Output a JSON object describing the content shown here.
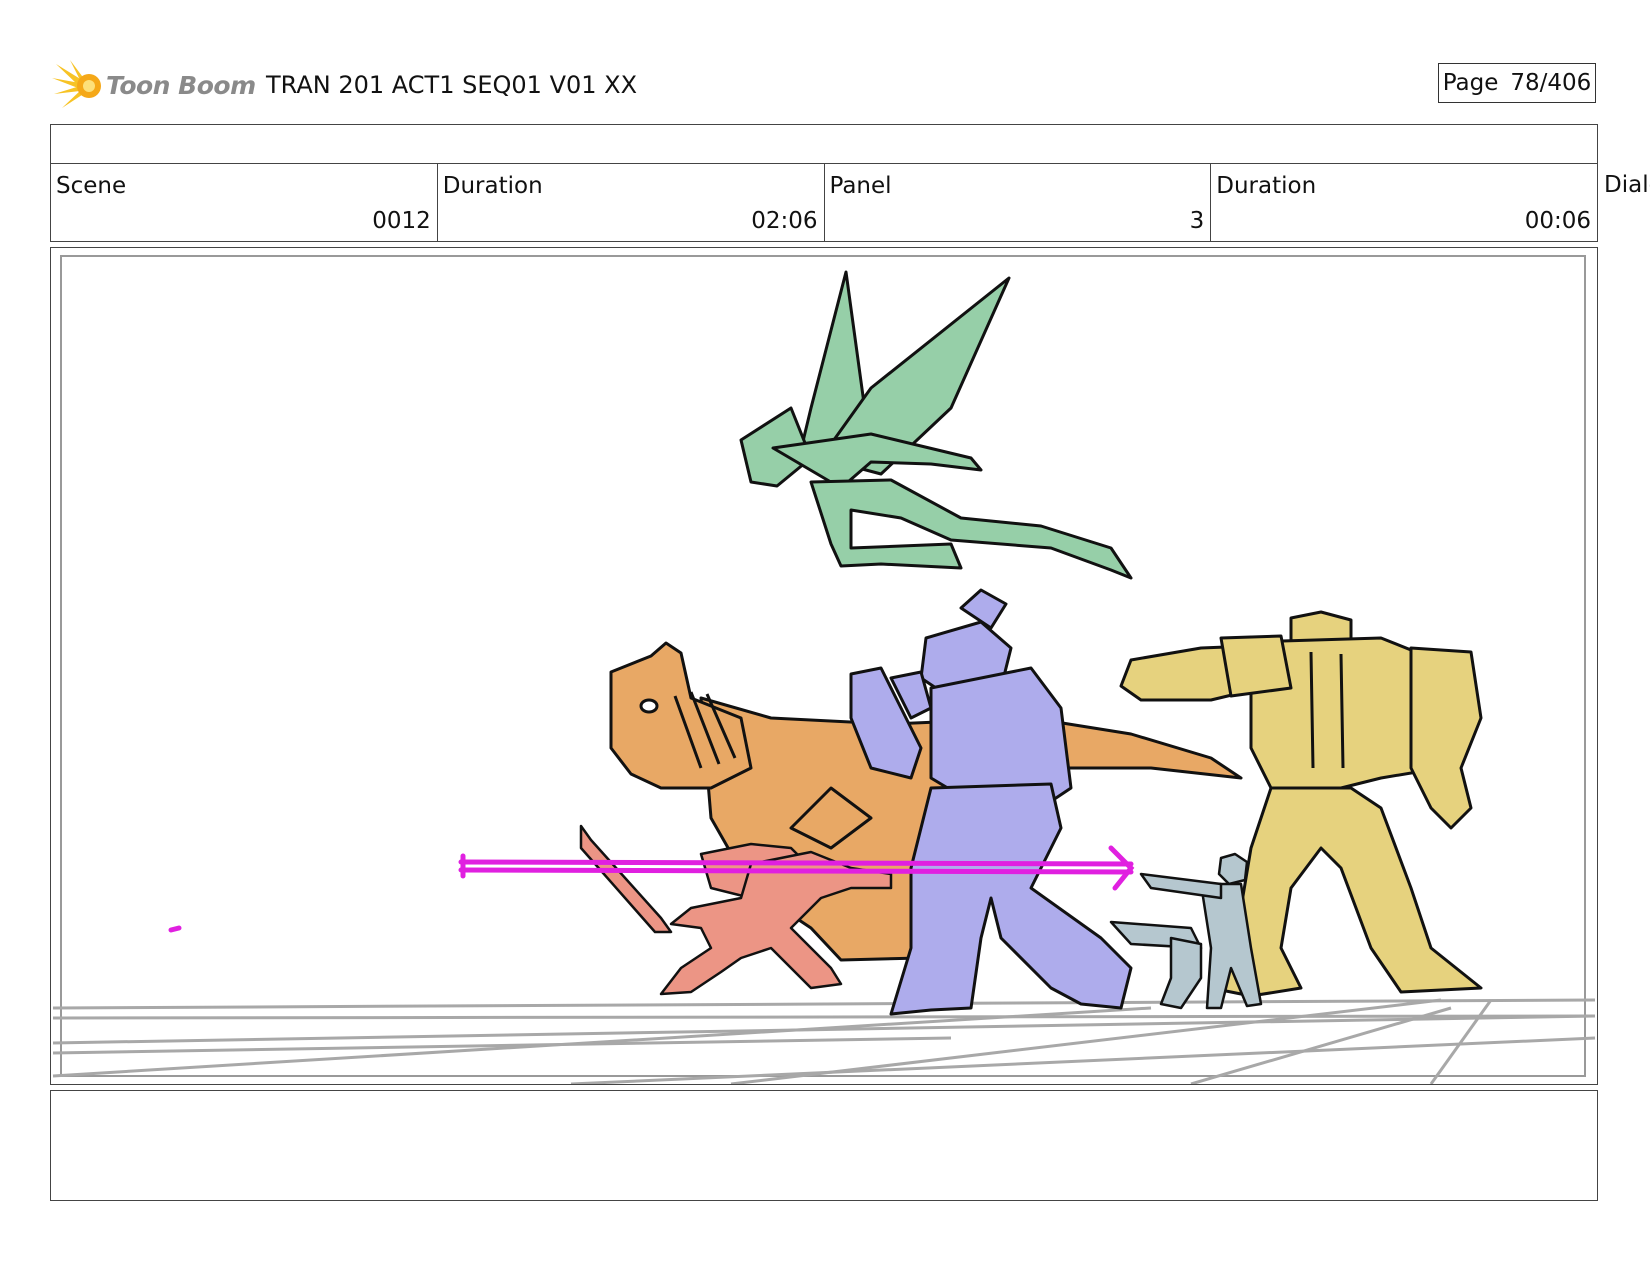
{
  "header": {
    "logo_text": "Toon Boom",
    "logo_icon": "sun-burst-icon",
    "title": "TRAN 201 ACT1 SEQ01 V01 XX",
    "page_label": "Page",
    "page_value": "78/406"
  },
  "info": {
    "scene_label": "Scene",
    "scene_value": "0012",
    "scene_duration_label": "Duration",
    "scene_duration_value": "02:06",
    "panel_label": "Panel",
    "panel_value": "3",
    "panel_duration_label": "Duration",
    "panel_duration_value": "00:06",
    "dialog_label": "Dialog"
  },
  "panel": {
    "characters": [
      {
        "name": "green-flyer",
        "color": "#96cfa8"
      },
      {
        "name": "orange-dinobot",
        "color": "#e8a865"
      },
      {
        "name": "purple-brawler",
        "color": "#aeacec"
      },
      {
        "name": "yellow-giant",
        "color": "#e6d27e"
      },
      {
        "name": "red-swordsman",
        "color": "#ec9585"
      },
      {
        "name": "grey-gunner",
        "color": "#b5c7cf"
      }
    ],
    "spear_color": "#e020e0",
    "ground_color": "#a8a8a8"
  }
}
